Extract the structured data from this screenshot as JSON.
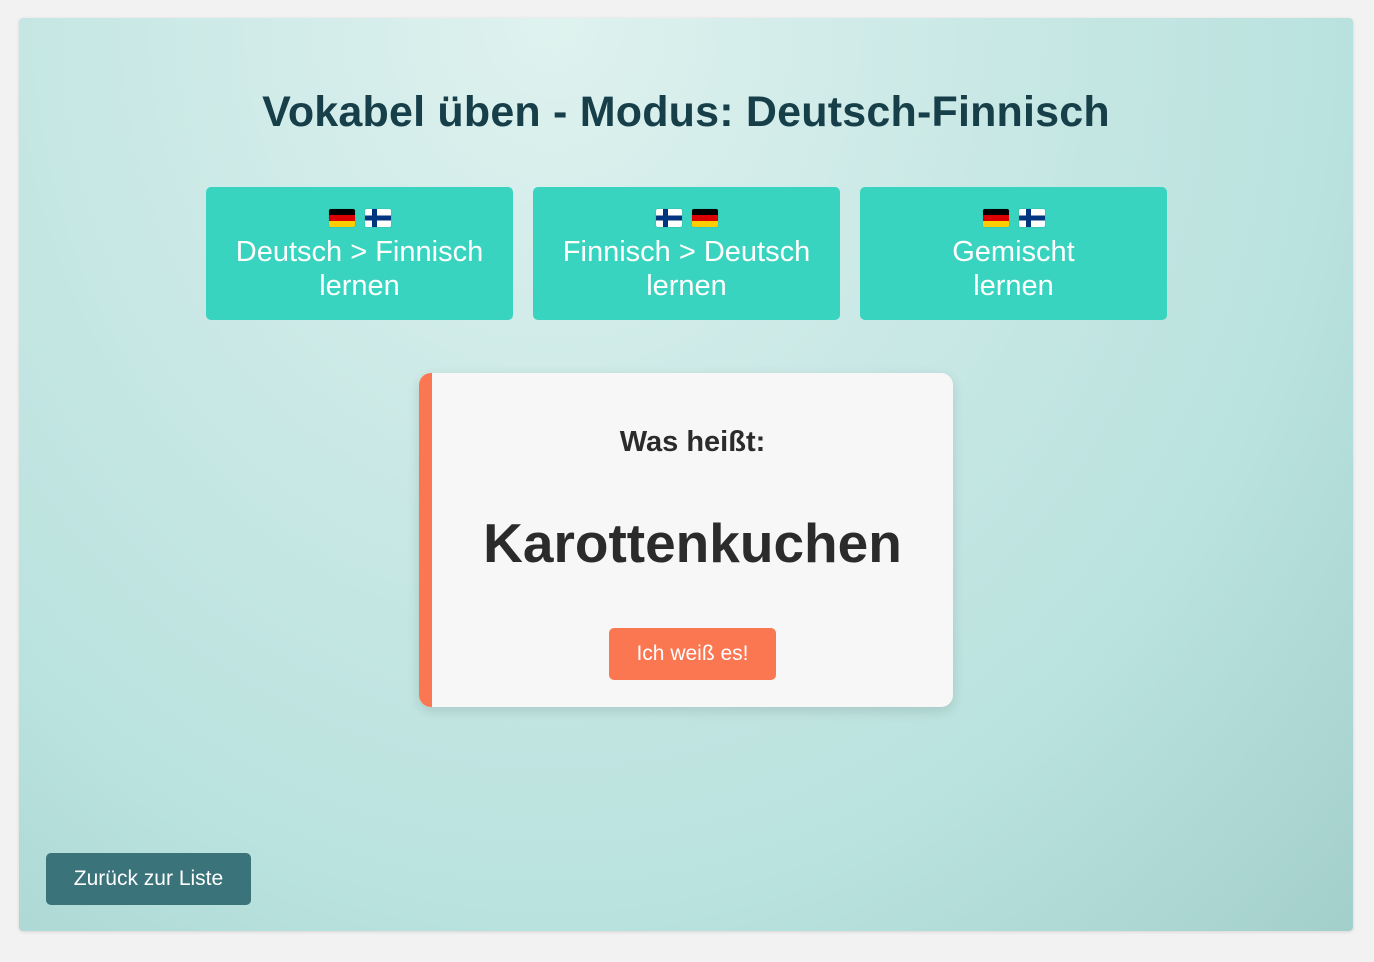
{
  "page": {
    "title": "Vokabel üben - Modus: Deutsch-Finnisch"
  },
  "modes": [
    {
      "flags": [
        "de-flag-icon",
        "fi-flag-icon"
      ],
      "line1": "Deutsch > Finnisch",
      "line2": "lernen"
    },
    {
      "flags": [
        "fi-flag-icon",
        "de-flag-icon"
      ],
      "line1": "Finnisch > Deutsch",
      "line2": "lernen"
    },
    {
      "flags": [
        "de-flag-icon",
        "fi-flag-icon"
      ],
      "line1": "Gemischt",
      "line2": "lernen"
    }
  ],
  "card": {
    "prompt": "Was heißt:",
    "word": "Karottenkuchen",
    "know_button": "Ich weiß es!"
  },
  "footer": {
    "back_button": "Zurück zur Liste"
  },
  "colors": {
    "title": "#173f4a",
    "mode_button": "#39d4bf",
    "accent": "#fa7752",
    "back_button": "#3a737a",
    "card_bg": "#f7f7f7"
  }
}
